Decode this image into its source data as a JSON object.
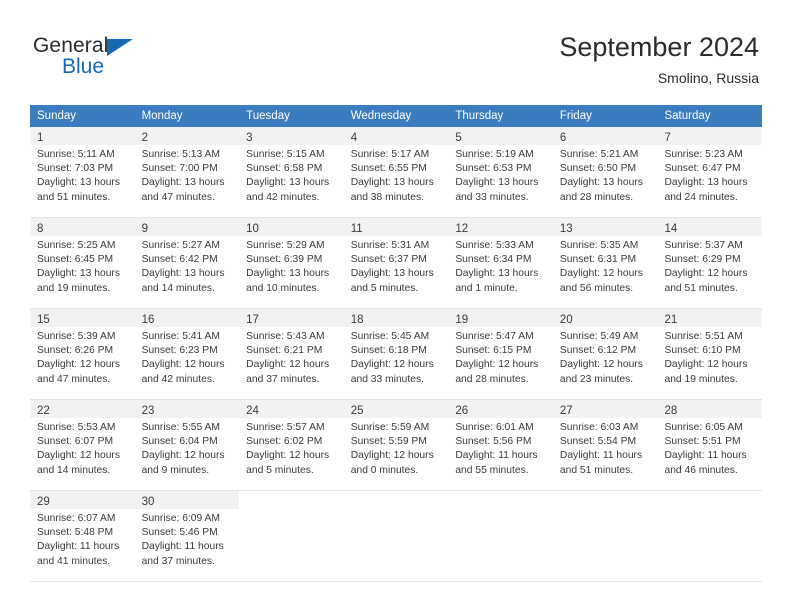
{
  "brand": {
    "line1": "General",
    "line2": "Blue",
    "flag_color": "#1668b3"
  },
  "header": {
    "title": "September 2024",
    "subtitle": "Smolino, Russia"
  },
  "theme": {
    "header_row_bg": "#3a7cbe",
    "daynum_bg": "#f2f2f2",
    "grid_line": "#e3e3e3",
    "text": "#3a3a3a"
  },
  "weekdays": [
    "Sunday",
    "Monday",
    "Tuesday",
    "Wednesday",
    "Thursday",
    "Friday",
    "Saturday"
  ],
  "weeks": [
    [
      {
        "day": "1",
        "sunrise": "Sunrise: 5:11 AM",
        "sunset": "Sunset: 7:03 PM",
        "daylight1": "Daylight: 13 hours",
        "daylight2": "and 51 minutes."
      },
      {
        "day": "2",
        "sunrise": "Sunrise: 5:13 AM",
        "sunset": "Sunset: 7:00 PM",
        "daylight1": "Daylight: 13 hours",
        "daylight2": "and 47 minutes."
      },
      {
        "day": "3",
        "sunrise": "Sunrise: 5:15 AM",
        "sunset": "Sunset: 6:58 PM",
        "daylight1": "Daylight: 13 hours",
        "daylight2": "and 42 minutes."
      },
      {
        "day": "4",
        "sunrise": "Sunrise: 5:17 AM",
        "sunset": "Sunset: 6:55 PM",
        "daylight1": "Daylight: 13 hours",
        "daylight2": "and 38 minutes."
      },
      {
        "day": "5",
        "sunrise": "Sunrise: 5:19 AM",
        "sunset": "Sunset: 6:53 PM",
        "daylight1": "Daylight: 13 hours",
        "daylight2": "and 33 minutes."
      },
      {
        "day": "6",
        "sunrise": "Sunrise: 5:21 AM",
        "sunset": "Sunset: 6:50 PM",
        "daylight1": "Daylight: 13 hours",
        "daylight2": "and 28 minutes."
      },
      {
        "day": "7",
        "sunrise": "Sunrise: 5:23 AM",
        "sunset": "Sunset: 6:47 PM",
        "daylight1": "Daylight: 13 hours",
        "daylight2": "and 24 minutes."
      }
    ],
    [
      {
        "day": "8",
        "sunrise": "Sunrise: 5:25 AM",
        "sunset": "Sunset: 6:45 PM",
        "daylight1": "Daylight: 13 hours",
        "daylight2": "and 19 minutes."
      },
      {
        "day": "9",
        "sunrise": "Sunrise: 5:27 AM",
        "sunset": "Sunset: 6:42 PM",
        "daylight1": "Daylight: 13 hours",
        "daylight2": "and 14 minutes."
      },
      {
        "day": "10",
        "sunrise": "Sunrise: 5:29 AM",
        "sunset": "Sunset: 6:39 PM",
        "daylight1": "Daylight: 13 hours",
        "daylight2": "and 10 minutes."
      },
      {
        "day": "11",
        "sunrise": "Sunrise: 5:31 AM",
        "sunset": "Sunset: 6:37 PM",
        "daylight1": "Daylight: 13 hours",
        "daylight2": "and 5 minutes."
      },
      {
        "day": "12",
        "sunrise": "Sunrise: 5:33 AM",
        "sunset": "Sunset: 6:34 PM",
        "daylight1": "Daylight: 13 hours",
        "daylight2": "and 1 minute."
      },
      {
        "day": "13",
        "sunrise": "Sunrise: 5:35 AM",
        "sunset": "Sunset: 6:31 PM",
        "daylight1": "Daylight: 12 hours",
        "daylight2": "and 56 minutes."
      },
      {
        "day": "14",
        "sunrise": "Sunrise: 5:37 AM",
        "sunset": "Sunset: 6:29 PM",
        "daylight1": "Daylight: 12 hours",
        "daylight2": "and 51 minutes."
      }
    ],
    [
      {
        "day": "15",
        "sunrise": "Sunrise: 5:39 AM",
        "sunset": "Sunset: 6:26 PM",
        "daylight1": "Daylight: 12 hours",
        "daylight2": "and 47 minutes."
      },
      {
        "day": "16",
        "sunrise": "Sunrise: 5:41 AM",
        "sunset": "Sunset: 6:23 PM",
        "daylight1": "Daylight: 12 hours",
        "daylight2": "and 42 minutes."
      },
      {
        "day": "17",
        "sunrise": "Sunrise: 5:43 AM",
        "sunset": "Sunset: 6:21 PM",
        "daylight1": "Daylight: 12 hours",
        "daylight2": "and 37 minutes."
      },
      {
        "day": "18",
        "sunrise": "Sunrise: 5:45 AM",
        "sunset": "Sunset: 6:18 PM",
        "daylight1": "Daylight: 12 hours",
        "daylight2": "and 33 minutes."
      },
      {
        "day": "19",
        "sunrise": "Sunrise: 5:47 AM",
        "sunset": "Sunset: 6:15 PM",
        "daylight1": "Daylight: 12 hours",
        "daylight2": "and 28 minutes."
      },
      {
        "day": "20",
        "sunrise": "Sunrise: 5:49 AM",
        "sunset": "Sunset: 6:12 PM",
        "daylight1": "Daylight: 12 hours",
        "daylight2": "and 23 minutes."
      },
      {
        "day": "21",
        "sunrise": "Sunrise: 5:51 AM",
        "sunset": "Sunset: 6:10 PM",
        "daylight1": "Daylight: 12 hours",
        "daylight2": "and 19 minutes."
      }
    ],
    [
      {
        "day": "22",
        "sunrise": "Sunrise: 5:53 AM",
        "sunset": "Sunset: 6:07 PM",
        "daylight1": "Daylight: 12 hours",
        "daylight2": "and 14 minutes."
      },
      {
        "day": "23",
        "sunrise": "Sunrise: 5:55 AM",
        "sunset": "Sunset: 6:04 PM",
        "daylight1": "Daylight: 12 hours",
        "daylight2": "and 9 minutes."
      },
      {
        "day": "24",
        "sunrise": "Sunrise: 5:57 AM",
        "sunset": "Sunset: 6:02 PM",
        "daylight1": "Daylight: 12 hours",
        "daylight2": "and 5 minutes."
      },
      {
        "day": "25",
        "sunrise": "Sunrise: 5:59 AM",
        "sunset": "Sunset: 5:59 PM",
        "daylight1": "Daylight: 12 hours",
        "daylight2": "and 0 minutes."
      },
      {
        "day": "26",
        "sunrise": "Sunrise: 6:01 AM",
        "sunset": "Sunset: 5:56 PM",
        "daylight1": "Daylight: 11 hours",
        "daylight2": "and 55 minutes."
      },
      {
        "day": "27",
        "sunrise": "Sunrise: 6:03 AM",
        "sunset": "Sunset: 5:54 PM",
        "daylight1": "Daylight: 11 hours",
        "daylight2": "and 51 minutes."
      },
      {
        "day": "28",
        "sunrise": "Sunrise: 6:05 AM",
        "sunset": "Sunset: 5:51 PM",
        "daylight1": "Daylight: 11 hours",
        "daylight2": "and 46 minutes."
      }
    ],
    [
      {
        "day": "29",
        "sunrise": "Sunrise: 6:07 AM",
        "sunset": "Sunset: 5:48 PM",
        "daylight1": "Daylight: 11 hours",
        "daylight2": "and 41 minutes."
      },
      {
        "day": "30",
        "sunrise": "Sunrise: 6:09 AM",
        "sunset": "Sunset: 5:46 PM",
        "daylight1": "Daylight: 11 hours",
        "daylight2": "and 37 minutes."
      },
      {
        "day": "",
        "sunrise": "",
        "sunset": "",
        "daylight1": "",
        "daylight2": ""
      },
      {
        "day": "",
        "sunrise": "",
        "sunset": "",
        "daylight1": "",
        "daylight2": ""
      },
      {
        "day": "",
        "sunrise": "",
        "sunset": "",
        "daylight1": "",
        "daylight2": ""
      },
      {
        "day": "",
        "sunrise": "",
        "sunset": "",
        "daylight1": "",
        "daylight2": ""
      },
      {
        "day": "",
        "sunrise": "",
        "sunset": "",
        "daylight1": "",
        "daylight2": ""
      }
    ]
  ]
}
